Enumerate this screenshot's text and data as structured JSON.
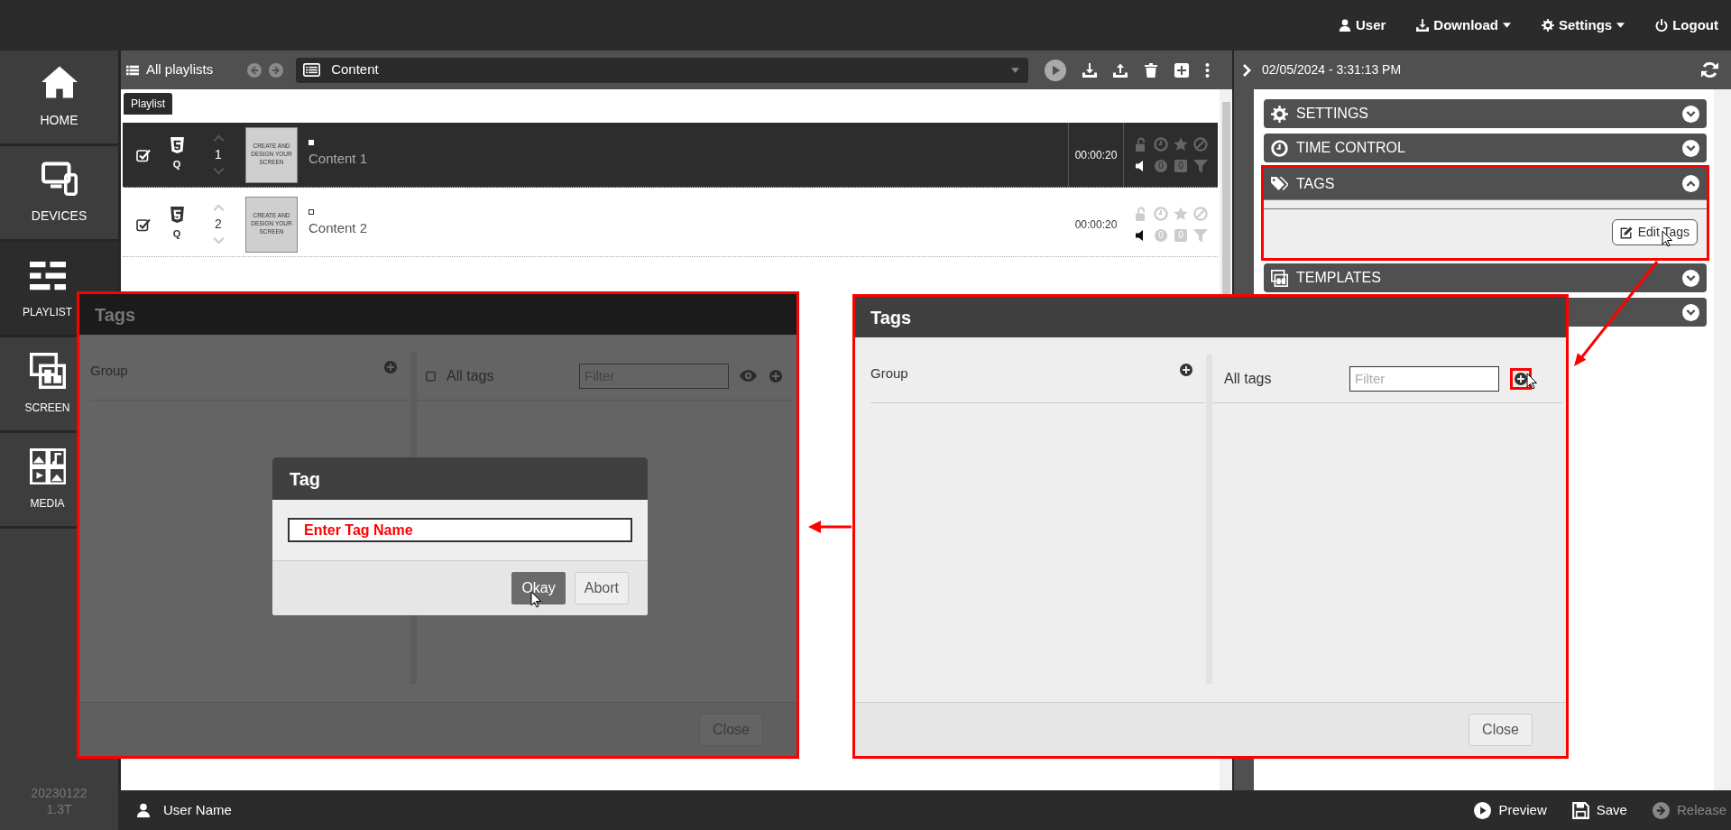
{
  "top_bar": {
    "menu": [
      {
        "label": "User",
        "dropdown": false
      },
      {
        "label": "Download",
        "dropdown": true
      },
      {
        "label": "Settings",
        "dropdown": true
      },
      {
        "label": "Logout",
        "dropdown": false
      }
    ]
  },
  "sidebar": {
    "items": [
      {
        "label": "HOME",
        "selected": false
      },
      {
        "label": "DEVICES",
        "selected": false
      },
      {
        "label": "PLAYLIST",
        "selected": true
      },
      {
        "label": "SCREEN",
        "selected": false
      },
      {
        "label": "MEDIA",
        "selected": false
      }
    ],
    "version": [
      "20230122",
      "1.3T"
    ]
  },
  "toolbar": {
    "title": "All playlists",
    "select": {
      "value": "Content"
    }
  },
  "playlist": {
    "tab": "Playlist",
    "rows": [
      {
        "selected": true,
        "checked": true,
        "type": "Q",
        "number": "1",
        "thumbnail_text": "CREATE AND DESIGN YOUR SCREEN",
        "title": "Content 1",
        "duration": "00:00:20",
        "counters": [
          "0",
          "0"
        ]
      },
      {
        "selected": false,
        "checked": true,
        "type": "Q",
        "number": "2",
        "thumbnail_text": "CREATE AND DESIGN YOUR SCREEN",
        "title": "Content 2",
        "duration": "00:00:20",
        "counters": [
          "0",
          "0"
        ]
      }
    ]
  },
  "right_panel": {
    "datetime": "02/05/2024 - 3:31:13 PM",
    "sections": [
      {
        "label": "SETTINGS",
        "expanded": false,
        "highlighted": false
      },
      {
        "label": "TIME CONTROL",
        "expanded": false,
        "highlighted": false
      },
      {
        "label": "TAGS",
        "expanded": true,
        "highlighted": true,
        "button": "Edit Tags"
      },
      {
        "label": "TEMPLATES",
        "expanded": false,
        "highlighted": false
      },
      {
        "expanded": false,
        "highlighted": false
      }
    ]
  },
  "tags_dialog_behind": {
    "title": "Tags",
    "dimmed": true,
    "highlighted": true,
    "group_label": "Group",
    "all_tags_checked": false,
    "all_tags_label": "All tags",
    "filter": {
      "placeholder": "Filter"
    },
    "add_highlighted": false,
    "close": "Close"
  },
  "tag_prompt": {
    "title": "Tag",
    "input": {
      "value": "Enter Tag Name"
    },
    "buttons": [
      {
        "label": "Okay",
        "primary": true
      },
      {
        "label": "Abort",
        "primary": false
      }
    ]
  },
  "tags_dialog": {
    "title": "Tags",
    "dimmed": false,
    "highlighted": true,
    "group_label": "Group",
    "all_tags_label": "All tags",
    "filter": {
      "placeholder": "Filter"
    },
    "add_highlighted": true,
    "close": "Close"
  },
  "status_bar": {
    "user": "User Name",
    "actions": [
      {
        "label": "Preview",
        "disabled": false
      },
      {
        "label": "Save",
        "disabled": false
      },
      {
        "label": "Release",
        "disabled": true
      }
    ]
  }
}
